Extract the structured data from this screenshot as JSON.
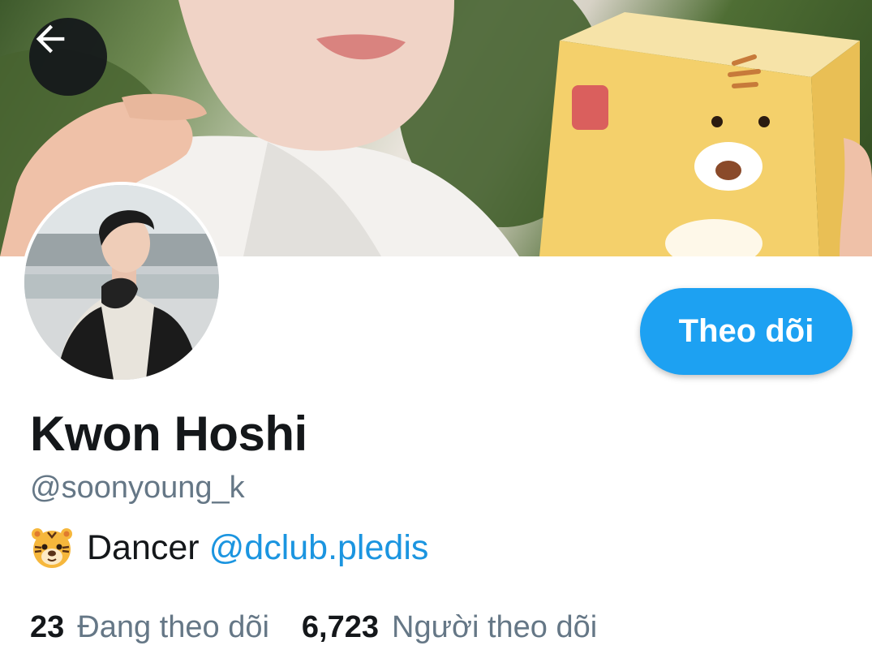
{
  "profile": {
    "display_name": "Kwon Hoshi",
    "handle": "@soonyoung_k",
    "bio_text": "Dancer",
    "bio_link": "@dclub.pledis",
    "bio_emoji": "tiger-face-icon"
  },
  "actions": {
    "back_icon": "arrow-left-icon",
    "follow_label": "Theo dõi"
  },
  "stats": {
    "following_count": "23",
    "following_label": "Đang theo dõi",
    "followers_count": "6,723",
    "followers_label": "Người theo dõi"
  },
  "colors": {
    "accent": "#1da1f2",
    "link": "#1b95e0",
    "secondary_text": "#657786",
    "primary_text": "#14171a"
  }
}
